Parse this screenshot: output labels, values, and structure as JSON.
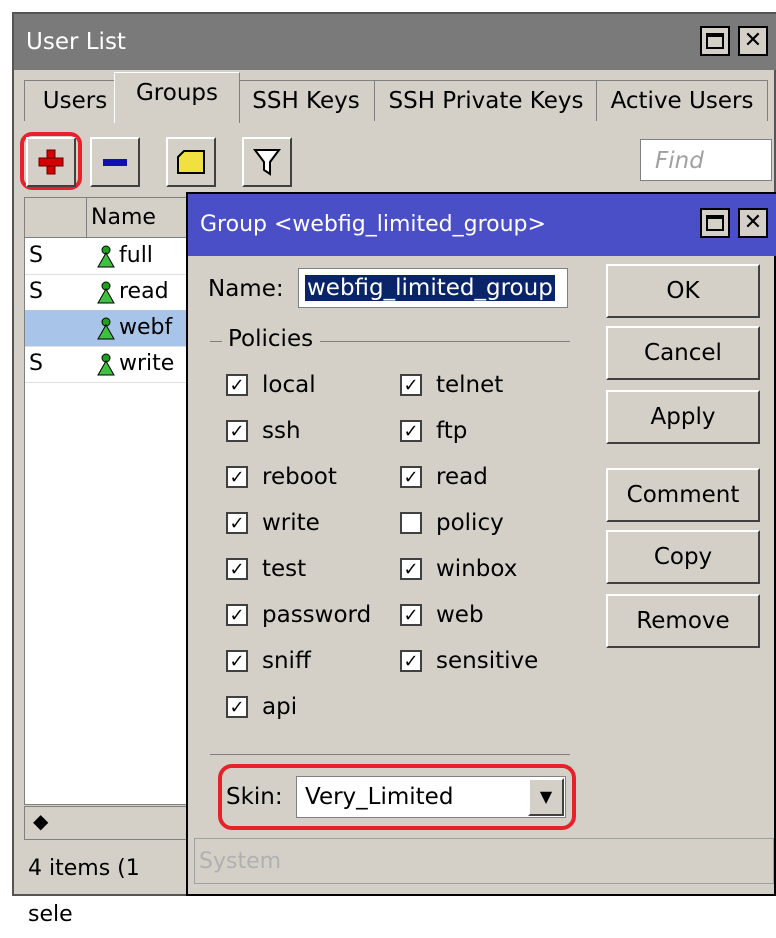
{
  "window": {
    "title": "User List"
  },
  "tabs": [
    "Users",
    "Groups",
    "SSH Keys",
    "SSH Private Keys",
    "Active Users"
  ],
  "toolbar": {
    "find_placeholder": "Find"
  },
  "list": {
    "columns": [
      "",
      "Name"
    ],
    "rows": [
      {
        "flag": "S",
        "name": "full"
      },
      {
        "flag": "S",
        "name": "read"
      },
      {
        "flag": "",
        "name": "webf"
      },
      {
        "flag": "S",
        "name": "write"
      }
    ],
    "status": "4 items (1 sele"
  },
  "dialog": {
    "title": "Group <webfig_limited_group>",
    "name_label": "Name:",
    "name_value": "webfig_limited_group",
    "policies_label": "Policies",
    "policies_left": [
      {
        "label": "local",
        "checked": true
      },
      {
        "label": "ssh",
        "checked": true
      },
      {
        "label": "reboot",
        "checked": true
      },
      {
        "label": "write",
        "checked": true
      },
      {
        "label": "test",
        "checked": true
      },
      {
        "label": "password",
        "checked": true
      },
      {
        "label": "sniff",
        "checked": true
      },
      {
        "label": "api",
        "checked": true
      }
    ],
    "policies_right": [
      {
        "label": "telnet",
        "checked": true
      },
      {
        "label": "ftp",
        "checked": true
      },
      {
        "label": "read",
        "checked": true
      },
      {
        "label": "policy",
        "checked": false
      },
      {
        "label": "winbox",
        "checked": true
      },
      {
        "label": "web",
        "checked": true
      },
      {
        "label": "sensitive",
        "checked": true
      }
    ],
    "buttons": [
      "OK",
      "Cancel",
      "Apply",
      "Comment",
      "Copy",
      "Remove"
    ],
    "skin_label": "Skin:",
    "skin_value": "Very_Limited",
    "status": "System"
  },
  "colors": {
    "highlight": "#e8202a",
    "dialog_title": "#4a4fc8",
    "selection": "#a8c4e8"
  }
}
